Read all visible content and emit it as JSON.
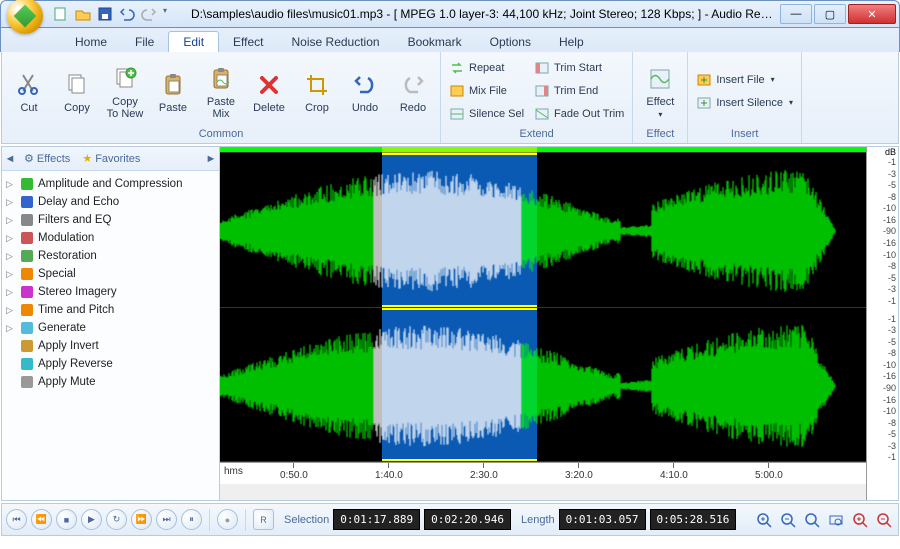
{
  "title": "D:\\samples\\audio files\\music01.mp3 - [ MPEG 1.0 layer-3: 44,100 kHz; Joint Stereo; 128 Kbps;  ] - Audio Re…",
  "menutabs": [
    "Home",
    "File",
    "Edit",
    "Effect",
    "Noise Reduction",
    "Bookmark",
    "Options",
    "Help"
  ],
  "active_tab": 2,
  "ribbon": {
    "groups": [
      {
        "label": "Common",
        "big": [
          {
            "id": "cut",
            "label": "Cut"
          },
          {
            "id": "copy",
            "label": "Copy"
          },
          {
            "id": "copynew",
            "label": "Copy\nTo New"
          },
          {
            "id": "paste",
            "label": "Paste"
          },
          {
            "id": "pastemix",
            "label": "Paste\nMix"
          },
          {
            "id": "delete",
            "label": "Delete"
          },
          {
            "id": "crop",
            "label": "Crop"
          },
          {
            "id": "undo",
            "label": "Undo"
          },
          {
            "id": "redo",
            "label": "Redo"
          }
        ]
      },
      {
        "label": "Extend",
        "small": [
          [
            {
              "id": "repeat",
              "label": "Repeat"
            },
            {
              "id": "mixfile",
              "label": "Mix File"
            },
            {
              "id": "silencesel",
              "label": "Silence Sel"
            }
          ],
          [
            {
              "id": "trimstart",
              "label": "Trim Start"
            },
            {
              "id": "trimend",
              "label": "Trim End"
            },
            {
              "id": "fadeout",
              "label": "Fade Out Trim"
            }
          ]
        ]
      },
      {
        "label": "Effect",
        "big": [
          {
            "id": "effect",
            "label": "Effect",
            "dropdown": true
          }
        ]
      },
      {
        "label": "Insert",
        "small": [
          [
            {
              "id": "insertfile",
              "label": "Insert File",
              "dropdown": true
            },
            {
              "id": "insertsilence",
              "label": "Insert Silence",
              "dropdown": true
            }
          ]
        ]
      }
    ]
  },
  "sidebar": {
    "tabs": [
      "Effects",
      "Favorites"
    ],
    "items": [
      {
        "icon": "fx-green",
        "label": "Amplitude and Compression"
      },
      {
        "icon": "fx-blue",
        "label": "Delay and Echo"
      },
      {
        "icon": "fx-eq",
        "label": "Filters and EQ"
      },
      {
        "icon": "fx-mod",
        "label": "Modulation"
      },
      {
        "icon": "fx-rest",
        "label": "Restoration"
      },
      {
        "icon": "fx-spec",
        "label": "Special"
      },
      {
        "icon": "fx-stereo",
        "label": "Stereo Imagery"
      },
      {
        "icon": "fx-time",
        "label": "Time and Pitch"
      },
      {
        "icon": "fx-gen",
        "label": "Generate"
      },
      {
        "icon": "fx-inv",
        "label": "Apply Invert",
        "leaf": true
      },
      {
        "icon": "fx-rev",
        "label": "Apply Reverse",
        "leaf": true
      },
      {
        "icon": "fx-mute",
        "label": "Apply Mute",
        "leaf": true
      }
    ]
  },
  "db_label": "dB",
  "db_ticks": [
    "-1",
    "-3",
    "-5",
    "-8",
    "-10",
    "-16",
    "-90",
    "-16",
    "-10",
    "-8",
    "-5",
    "-3",
    "-1"
  ],
  "time_ticks": [
    "0:50.0",
    "1:40.0",
    "2:30.0",
    "3:20.0",
    "4:10.0",
    "5:00.0"
  ],
  "hms": "hms",
  "status": {
    "selection_label": "Selection",
    "sel_start": "0:01:17.889",
    "sel_end": "0:02:20.946",
    "length_label": "Length",
    "sel_len": "0:01:03.057",
    "total_len": "0:05:28.516"
  },
  "colors": {
    "wave": "#00ff00",
    "wave_sel": "#ffffff",
    "sel_bg": "#0a5ab4"
  }
}
